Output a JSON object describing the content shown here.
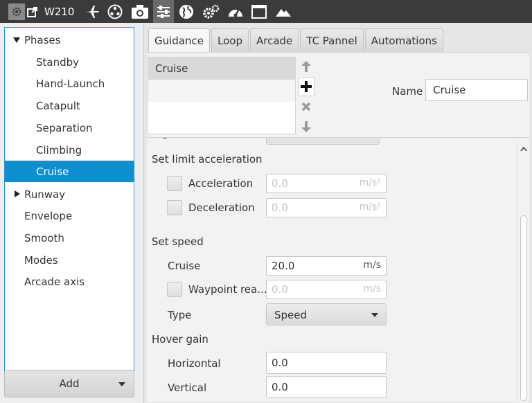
{
  "toolbar": {
    "title": "W210",
    "icons": [
      "settings-gear-icon",
      "external-link-icon",
      "airplane-icon",
      "radiation-icon",
      "camera-icon",
      "sliders-icon",
      "globe-icon",
      "gears-icon",
      "speedometer-icon",
      "window-icon",
      "mountain-icon"
    ],
    "active_icon": "sliders-icon"
  },
  "tree": {
    "items": [
      {
        "label": "Phases",
        "level": 0,
        "expander": "expanded"
      },
      {
        "label": "Standby",
        "level": 1
      },
      {
        "label": "Hand-Launch",
        "level": 1
      },
      {
        "label": "Catapult",
        "level": 1
      },
      {
        "label": "Separation",
        "level": 1
      },
      {
        "label": "Climbing",
        "level": 1
      },
      {
        "label": "Cruise",
        "level": 1,
        "selected": true
      },
      {
        "label": "Runway",
        "level": 0,
        "expander": "collapsed"
      },
      {
        "label": "Envelope",
        "level": 0
      },
      {
        "label": "Smooth",
        "level": 0
      },
      {
        "label": "Modes",
        "level": 0
      },
      {
        "label": "Arcade axis",
        "level": 0
      }
    ]
  },
  "add_button": {
    "label": "Add"
  },
  "tabs": [
    {
      "label": "Guidance",
      "active": true
    },
    {
      "label": "Loop"
    },
    {
      "label": "Arcade"
    },
    {
      "label": "TC Pannel"
    },
    {
      "label": "Automations"
    }
  ],
  "guidance_list": {
    "items": [
      "Cruise",
      "",
      ""
    ]
  },
  "name_field": {
    "label": "Name",
    "value": "Cruise"
  },
  "form": {
    "limit_acceleration": {
      "title": "Set limit acceleration",
      "acceleration": {
        "label": "Acceleration",
        "value": "0.0",
        "unit": "m/s²",
        "checked": false
      },
      "deceleration": {
        "label": "Deceleration",
        "value": "0.0",
        "unit": "m/s²",
        "checked": false
      }
    },
    "set_speed": {
      "title": "Set speed",
      "cruise": {
        "label": "Cruise",
        "value": "20.0",
        "unit": "m/s"
      },
      "waypoint": {
        "label": "Waypoint rea...",
        "value": "0.0",
        "unit": "m/s",
        "checked": false
      },
      "type": {
        "label": "Type",
        "value": "Speed"
      }
    },
    "hover_gain": {
      "title": "Hover gain",
      "horizontal": {
        "label": "Horizontal",
        "value": "0.0"
      },
      "vertical": {
        "label": "Vertical",
        "value": "0.0"
      }
    }
  },
  "colors": {
    "toolbar_bg": "#3b3b3b",
    "selection": "#0f8fd0",
    "tree_border": "#2f92d0"
  }
}
